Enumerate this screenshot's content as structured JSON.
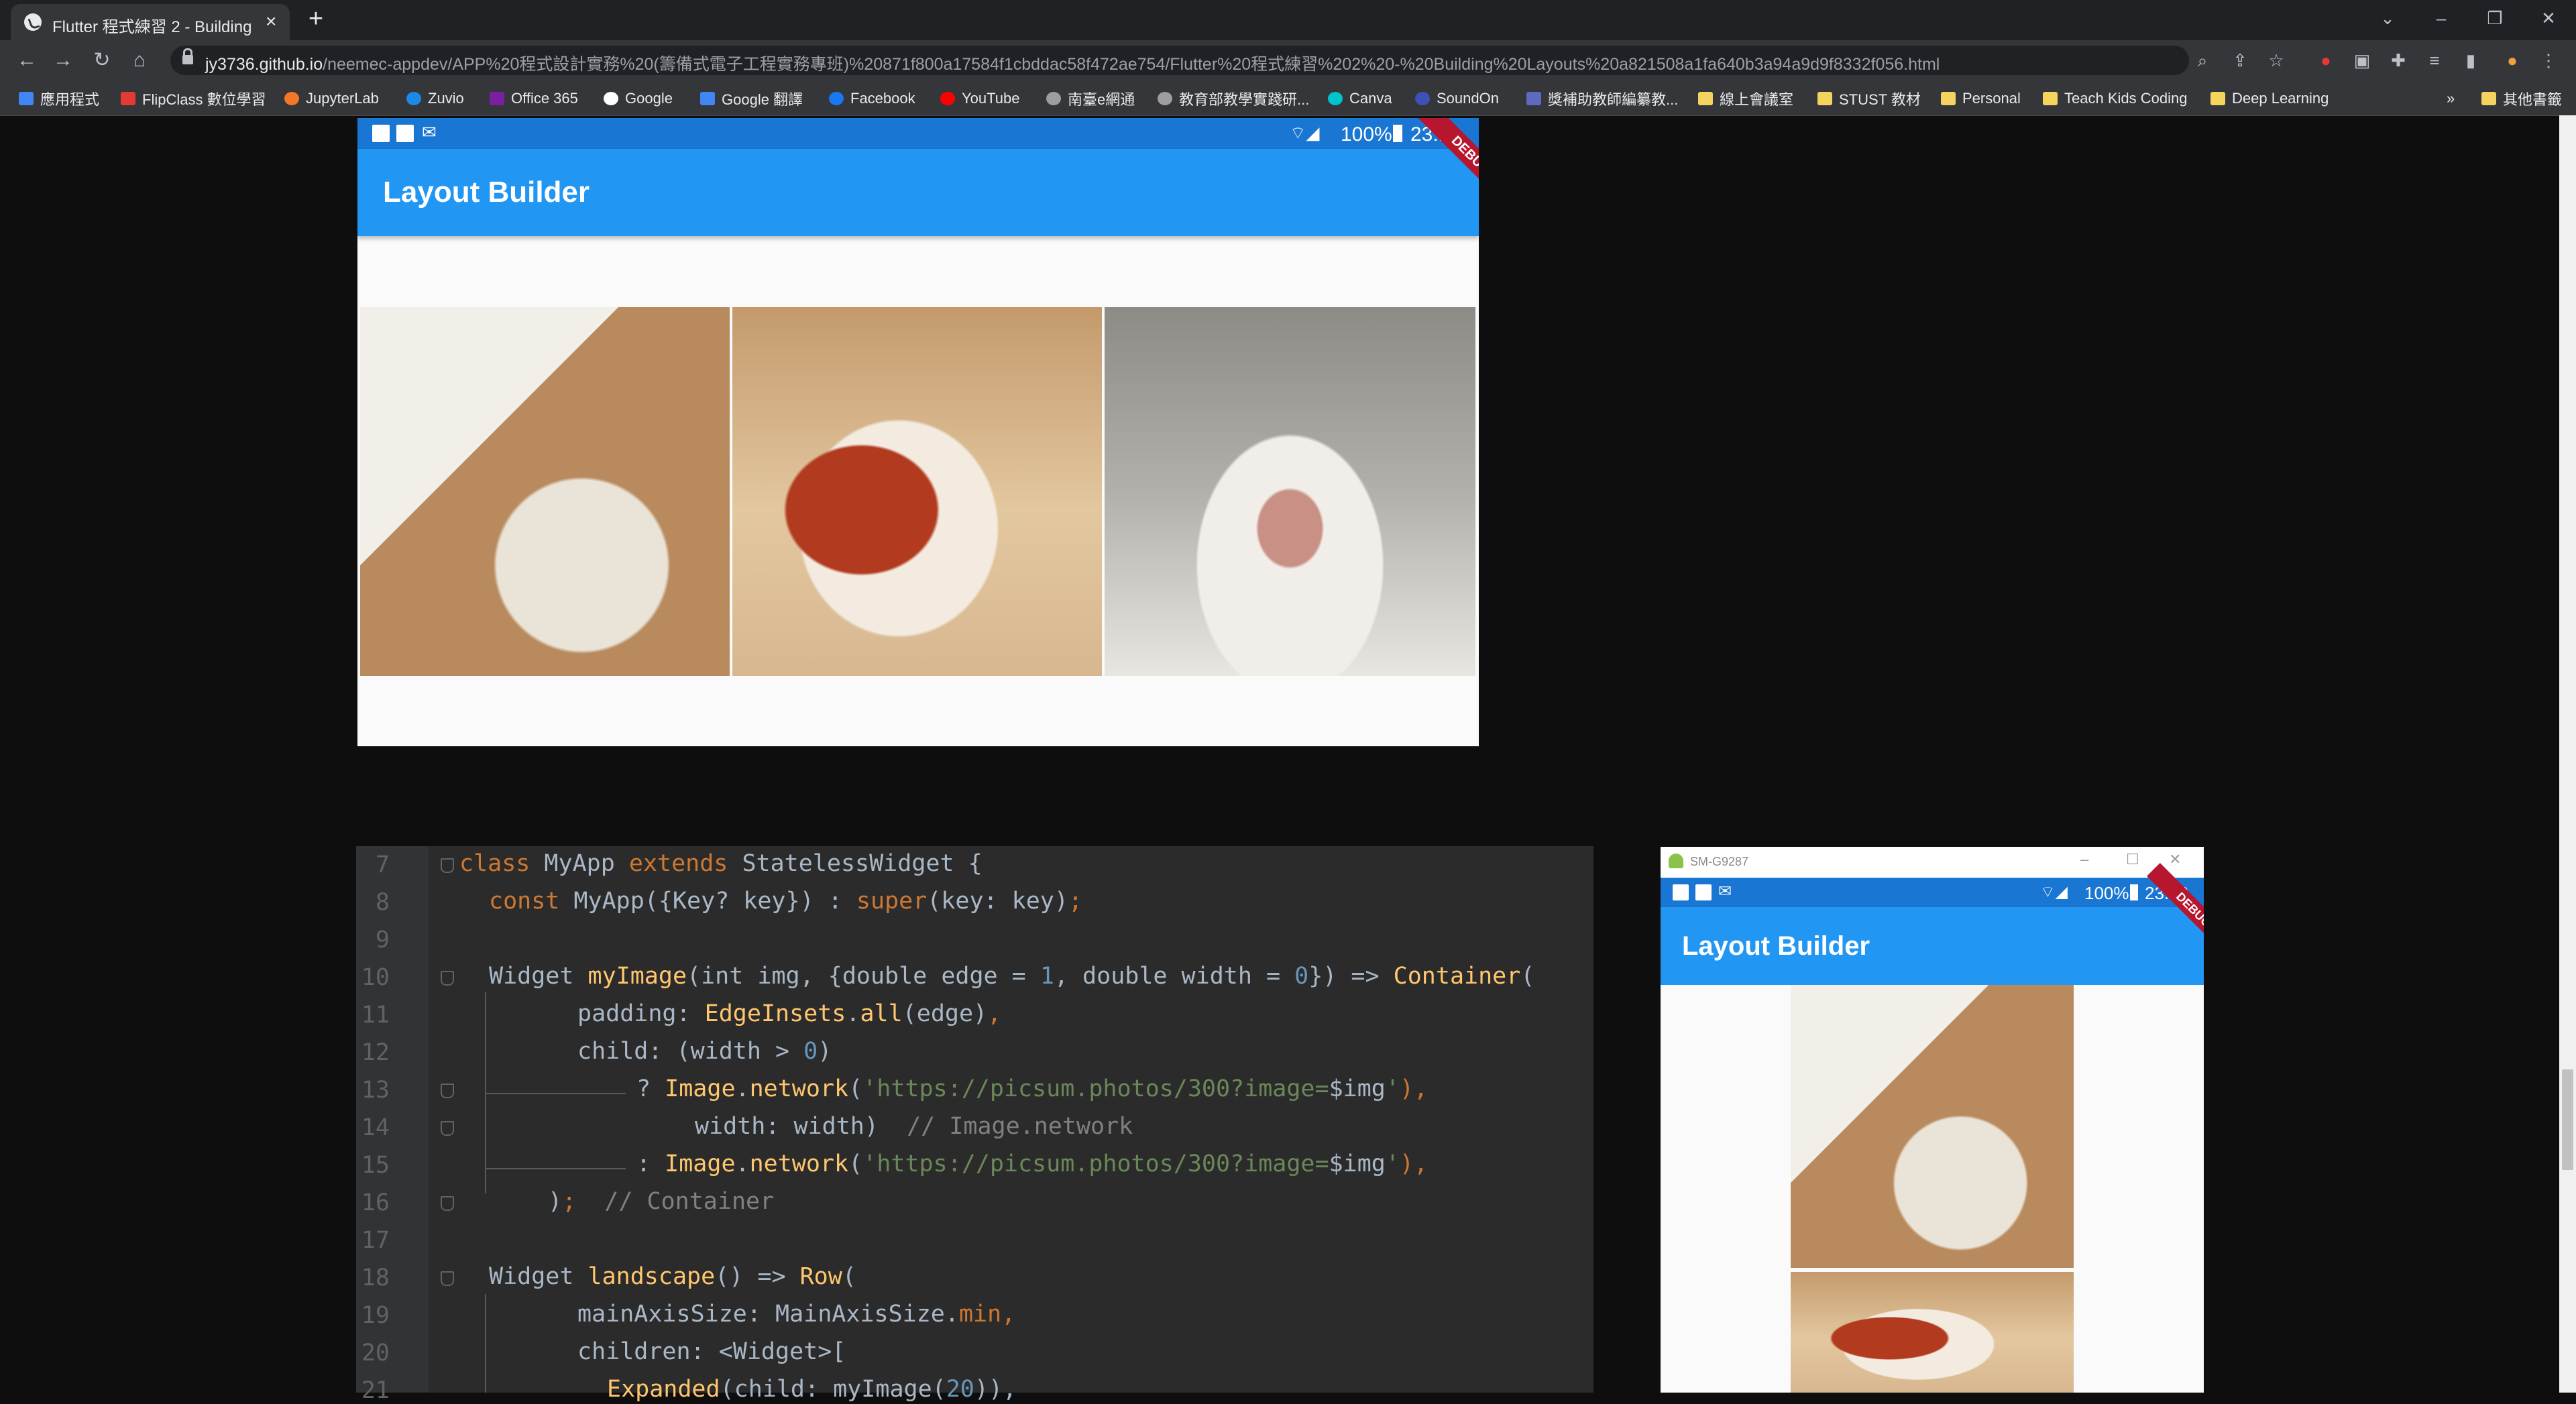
{
  "browser": {
    "tab_title": "Flutter 程式練習 2 - Building Layouts",
    "tab_close": "×",
    "new_tab": "+",
    "url_host": "jy3736.github.io",
    "url_path": "/neemec-appdev/APP%20程式設計實務%20(籌備式電子工程實務專班)%20871f800a17584f1cbddac58f472ae754/Flutter%20程式練習%202%20-%20Building%20Layouts%20a821508a1fa640b3a94a9d9f8332f056.html",
    "bookmarks": [
      {
        "label": "應用程式",
        "color": "#4285f4"
      },
      {
        "label": "FlipClass 數位學習",
        "color": "#e53935"
      },
      {
        "label": "JupyterLab",
        "color": "#f37726"
      },
      {
        "label": "Zuvio",
        "color": "#1e88e5"
      },
      {
        "label": "Office 365",
        "color": "#7b1fa2"
      },
      {
        "label": "Google",
        "color": "#ffffff"
      },
      {
        "label": "Google 翻譯",
        "color": "#4285f4"
      },
      {
        "label": "Facebook",
        "color": "#1877f2"
      },
      {
        "label": "YouTube",
        "color": "#ff0000"
      },
      {
        "label": "南臺e網通",
        "color": "#9e9e9e"
      },
      {
        "label": "教育部教學實踐研...",
        "color": "#9e9e9e"
      },
      {
        "label": "Canva",
        "color": "#00c4cc"
      },
      {
        "label": "SoundOn",
        "color": "#3f51b5"
      },
      {
        "label": "獎補助教師編纂教...",
        "color": "#5c6bc0"
      },
      {
        "label": "線上會議室",
        "color": "#f4d35e"
      },
      {
        "label": "STUST 教材",
        "color": "#f4d35e"
      },
      {
        "label": "Personal",
        "color": "#f4d35e"
      },
      {
        "label": "Teach Kids Coding",
        "color": "#f4d35e"
      },
      {
        "label": "Deep Learning",
        "color": "#f4d35e"
      }
    ],
    "more_bookmarks": "»",
    "other_bookmarks": "其他書籤"
  },
  "phone1": {
    "status_battery": "100%",
    "status_time": "23:10",
    "appbar_title": "Layout Builder",
    "debug_ribbon": "DEBUG"
  },
  "editor": {
    "lines": [
      {
        "n": "7"
      },
      {
        "n": "8"
      },
      {
        "n": "9"
      },
      {
        "n": "10"
      },
      {
        "n": "11"
      },
      {
        "n": "12"
      },
      {
        "n": "13"
      },
      {
        "n": "14"
      },
      {
        "n": "15"
      },
      {
        "n": "16"
      },
      {
        "n": "17"
      },
      {
        "n": "18"
      },
      {
        "n": "19"
      },
      {
        "n": "20"
      },
      {
        "n": "21"
      }
    ],
    "tokens": {
      "l7a": "class",
      "l7b": " MyApp ",
      "l7c": "extends",
      "l7d": " StatelessWidget {",
      "l8a": "const",
      "l8b": " MyApp({Key? key}) : ",
      "l8c": "super",
      "l8d": "(key: key)",
      "l8e": ";",
      "l10a": "Widget ",
      "l10b": "myImage",
      "l10c": "(int img, {double edge = ",
      "l10d": "1",
      "l10e": ", double width = ",
      "l10f": "0",
      "l10g": "}) => ",
      "l10h": "Container",
      "l10i": "(",
      "l11a": "padding: ",
      "l11b": "EdgeInsets",
      "l11c": ".",
      "l11d": "all",
      "l11e": "(edge)",
      "l11f": ",",
      "l12a": "child: (width > ",
      "l12b": "0",
      "l12c": ")",
      "l13a": "? ",
      "l13b": "Image",
      "l13c": ".",
      "l13d": "network",
      "l13e": "(",
      "l13f": "'https://picsum.photos/300?image=",
      "l13g": "$img",
      "l13h": "'",
      "l13i": "),",
      "l14a": "width: width)  ",
      "l14b": "// Image.network",
      "l15a": ": ",
      "l15b": "Image",
      "l15c": ".",
      "l15d": "network",
      "l15e": "(",
      "l15f": "'https://picsum.photos/300?image=",
      "l15g": "$img",
      "l15h": "'",
      "l15i": "),",
      "l16a": ")",
      "l16b": ";",
      "l16c": "  // Container",
      "l18a": "Widget ",
      "l18b": "landscape",
      "l18c": "() => ",
      "l18d": "Row",
      "l18e": "(",
      "l19a": "mainAxisSize: MainAxisSize.",
      "l19b": "min",
      "l19c": ",",
      "l20a": "children: <Widget>[",
      "l21a": "Expanded",
      "l21b": "(child: myImage(",
      "l21c": "20",
      "l21d": ")),"
    }
  },
  "emulator": {
    "window_title": "SM-G9287",
    "status_battery": "100%",
    "status_time": "23:10",
    "appbar_title": "Layout Builder",
    "debug_ribbon": "DEBUG"
  }
}
